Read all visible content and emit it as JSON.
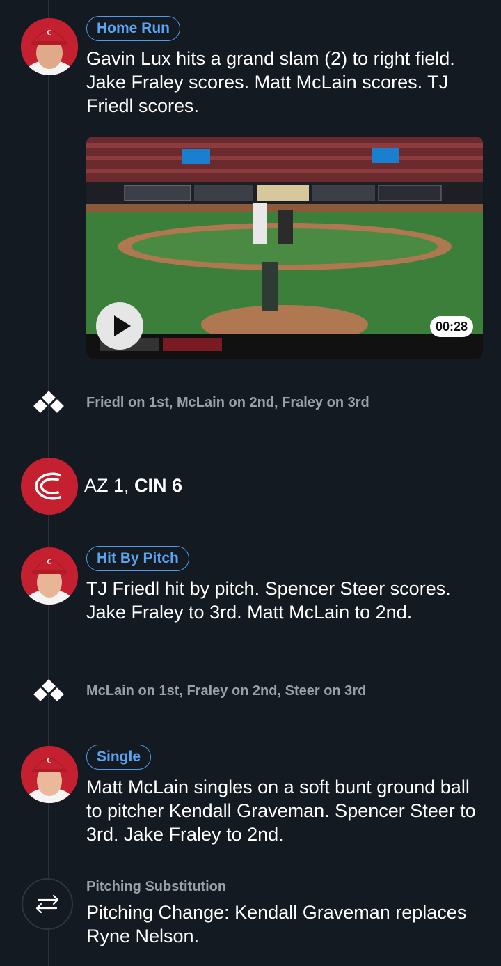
{
  "events": [
    {
      "type": "Home Run",
      "text": "Gavin Lux hits a grand slam (2) to right field. Jake Fraley scores. Matt McLain scores. TJ Friedl scores.",
      "avatar_icon": "player-headshot-icon",
      "video": {
        "duration": "00:28",
        "play_icon": "play-icon"
      }
    },
    {
      "type": "runners",
      "text": "Friedl on 1st, McLain on 2nd, Fraley on 3rd",
      "icon": "bases-icon"
    },
    {
      "type": "score",
      "away": "AZ 1,",
      "home": "CIN 6",
      "icon": "cincinnati-reds-logo"
    },
    {
      "type": "Hit By Pitch",
      "text": "TJ Friedl hit by pitch. Spencer Steer scores. Jake Fraley to 3rd. Matt McLain to 2nd.",
      "avatar_icon": "player-headshot-icon"
    },
    {
      "type": "runners",
      "text": "McLain on 1st, Fraley on 2nd, Steer on 3rd",
      "icon": "bases-icon"
    },
    {
      "type": "Single",
      "text": "Matt McLain singles on a soft bunt ground ball to pitcher Kendall Graveman. Spencer Steer to 3rd. Jake Fraley to 2nd.",
      "avatar_icon": "player-headshot-icon"
    },
    {
      "type": "Pitching Substitution",
      "text": "Pitching Change: Kendall Graveman replaces Ryne Nelson.",
      "icon": "swap-arrows-icon"
    }
  ],
  "colors": {
    "background": "#141a21",
    "accent": "#4f9bec",
    "reds": "#c4202f",
    "muted": "#9aa0a6"
  }
}
